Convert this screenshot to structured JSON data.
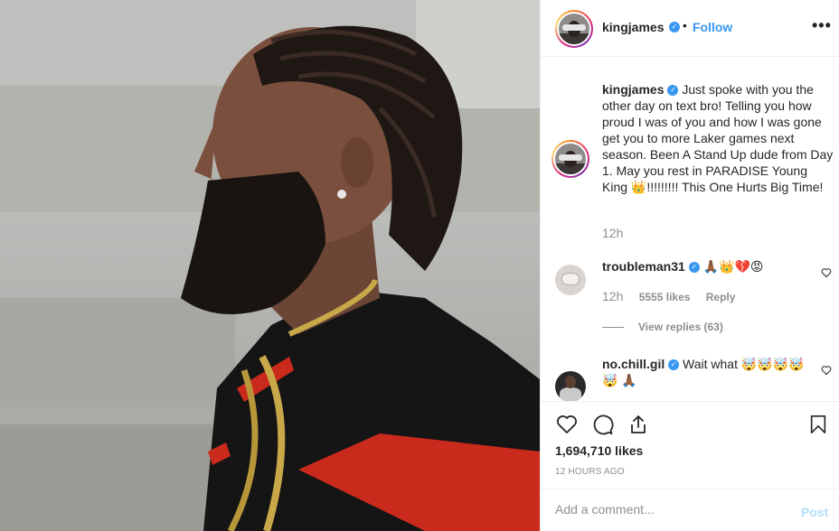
{
  "post": {
    "author": "kingjames",
    "verified_icon": "verified-badge-icon",
    "follow_label": "Follow",
    "more_label": "•••",
    "separator": "•"
  },
  "caption": {
    "author": "kingjames",
    "text": "Just spoke with you the other day on text bro! Telling you how proud I was of you and how I was gone get you to more Laker games next season. Been A Stand Up dude from Day 1. May you rest in PARADISE Young King 👑!!!!!!!!! This One Hurts Big Time!",
    "time": "12h"
  },
  "comments": [
    {
      "author": "troubleman31",
      "text": "🙏🏾👑💔😡",
      "time": "12h",
      "likes": "5555 likes",
      "reply_label": "Reply",
      "view_replies": "View replies (63)"
    },
    {
      "author": "no.chill.gil",
      "text": "Wait what 🤯🤯🤯🤯🤯 🙏🏾"
    }
  ],
  "actions": {
    "like_icon": "heart-icon",
    "comment_icon": "comment-bubble-icon",
    "share_icon": "share-icon",
    "save_icon": "bookmark-icon",
    "likes_count": "1,694,710 likes",
    "posted_ago": "12 HOURS AGO"
  },
  "composer": {
    "placeholder": "Add a comment...",
    "post_label": "Post"
  },
  "colors": {
    "link_blue": "#3897f0",
    "post_disabled": "#b2dffc",
    "muted_text": "#8e8e8e"
  }
}
